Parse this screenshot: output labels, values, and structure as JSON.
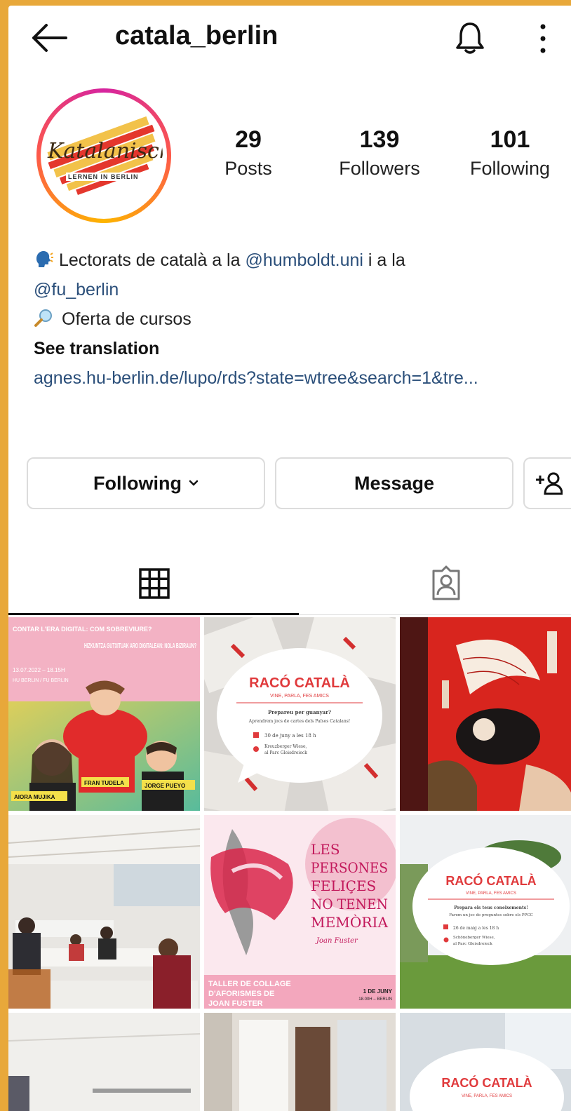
{
  "header": {
    "username": "catala_berlin"
  },
  "avatar": {
    "script_text": "Katalanisch",
    "sub_text": "LERNEN IN BERLIN"
  },
  "stats": [
    {
      "value": "29",
      "label": "Posts"
    },
    {
      "value": "139",
      "label": "Followers"
    },
    {
      "value": "101",
      "label": "Following"
    }
  ],
  "bio": {
    "line1_prefix": "Lectorats de català a la ",
    "line1_mention": "@humboldt.uni",
    "line1_suffix": " i a la",
    "line2_mention": "@fu_berlin",
    "line3": "Oferta de cursos",
    "see_translation": "See translation",
    "link": "agnes.hu-berlin.de/lupo/rds?state=wtree&search=1&tre..."
  },
  "buttons": {
    "following": "Following",
    "message": "Message"
  },
  "posts": {
    "post1": {
      "top_left": "CONTAR L'ERA DIGITAL: COM SOBREVIURE?",
      "date": "13.07.2022 – 18.15H",
      "place": "HU BERLIN / FU BERLIN",
      "title_right": "HIZKUNTZA GUTXITUAK ARO DIGITALEAN: NOLA BIZIRAUN?",
      "person1": "AIORA MUJIKA",
      "person2": "FRAN TUDELA",
      "person3": "JORGE PUEYO"
    },
    "post2": {
      "title": "RACÓ CATALÀ",
      "subtitle": "VINE, PARLA, FES AMICS",
      "line1": "Prepareu per guanyar?",
      "line2": "Aprendrem jocs de cartes dels Països Catalans!",
      "when": "30 de juny a les 18 h",
      "where1": "Kreuzberger Wiese,",
      "where2": "al Parc Gleisdreieck"
    },
    "post5": {
      "quote1": "LES",
      "quote2": "PERSONES",
      "quote3": "FELIÇES",
      "quote4": "NO TENEN",
      "quote5": "MEMÒRIA",
      "author": "Joan Fuster",
      "bottom1": "TALLER DE COLLAGE",
      "bottom2": "D'AFORISMES DE",
      "bottom3": "JOAN FUSTER",
      "date": "1 DE JUNY",
      "time": "18.00H – BERLIN"
    },
    "post6": {
      "title": "RACÓ CATALÀ",
      "subtitle": "VINE, PARLA, FES AMICS",
      "line1": "Prepara els teus coneixements!",
      "line2": "Farem un joc de preguntes sobre els PPCC",
      "when": "26 de maig a les 18 h",
      "where1": "Schöneberger Wiese,",
      "where2": "al Parc Gleisdreieck"
    },
    "post9": {
      "title": "RACÓ CATALÀ",
      "subtitle": "VINE, PARLA, FES AMICS"
    }
  },
  "colors": {
    "link": "#2b4f7a",
    "accent_red": "#e03a3c",
    "poster_pink": "#f3b2c4",
    "border": "#dcdcdc"
  },
  "icons": [
    "back-arrow-icon",
    "bell-icon",
    "more-vertical-icon",
    "speaking-head-emoji",
    "magnifier-emoji",
    "chevron-down-icon",
    "add-person-icon",
    "grid-icon",
    "tagged-icon"
  ]
}
